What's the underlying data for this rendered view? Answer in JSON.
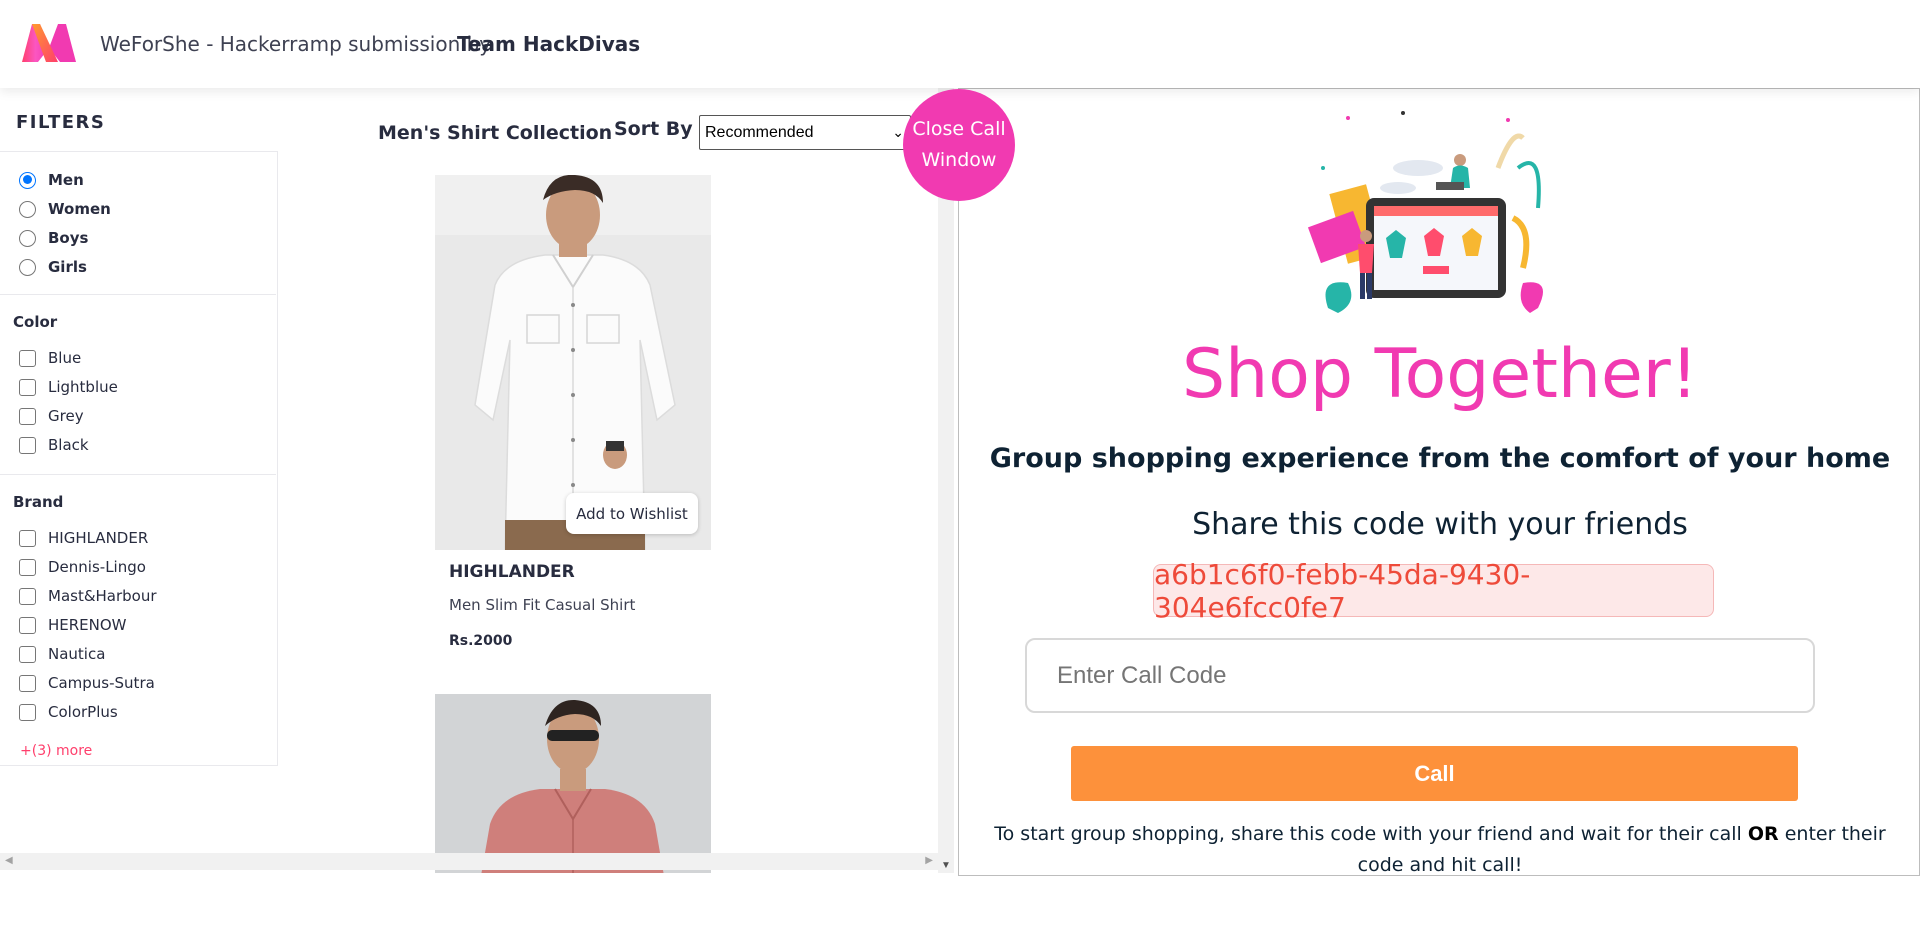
{
  "header": {
    "title": "WeForShe - Hackerramp submission by",
    "team": "Team HackDivas"
  },
  "filters": {
    "heading": "FILTERS",
    "gender": [
      {
        "label": "Men",
        "checked": true
      },
      {
        "label": "Women",
        "checked": false
      },
      {
        "label": "Boys",
        "checked": false
      },
      {
        "label": "Girls",
        "checked": false
      }
    ],
    "color_title": "Color",
    "colors": [
      "Blue",
      "Lightblue",
      "Grey",
      "Black"
    ],
    "brand_title": "Brand",
    "brands": [
      "HIGHLANDER",
      "Dennis-Lingo",
      "Mast&Harbour",
      "HERENOW",
      "Nautica",
      "Campus-Sutra",
      "ColorPlus"
    ],
    "more": "+(3) more"
  },
  "collection": {
    "title": "Men's Shirt Collection",
    "sort_label": "Sort By :",
    "sort_value": "Recommended"
  },
  "products": [
    {
      "brand": "HIGHLANDER",
      "name": "Men Slim Fit Casual Shirt",
      "price": "Rs.2000",
      "wishlist": "Add to Wishlist"
    }
  ],
  "call_panel": {
    "close_label_line1": "Close Call",
    "close_label_line2": "Window",
    "title": "Shop Together!",
    "tagline": "Group shopping experience from the comfort of your home",
    "share_text": "Share this code with your friends",
    "code": "a6b1c6f0-febb-45da-9430-304e6fcc0fe7",
    "input_placeholder": "Enter Call Code",
    "call_button": "Call",
    "instructions_part1": "To start group shopping, share this code with your friend and wait for their call",
    "instructions_or": "OR",
    "instructions_part2": "enter their code and hit call!"
  },
  "colors": {
    "accent_pink": "#f13ab1",
    "call_orange": "#fd913b",
    "code_red": "#ee4a3a"
  }
}
